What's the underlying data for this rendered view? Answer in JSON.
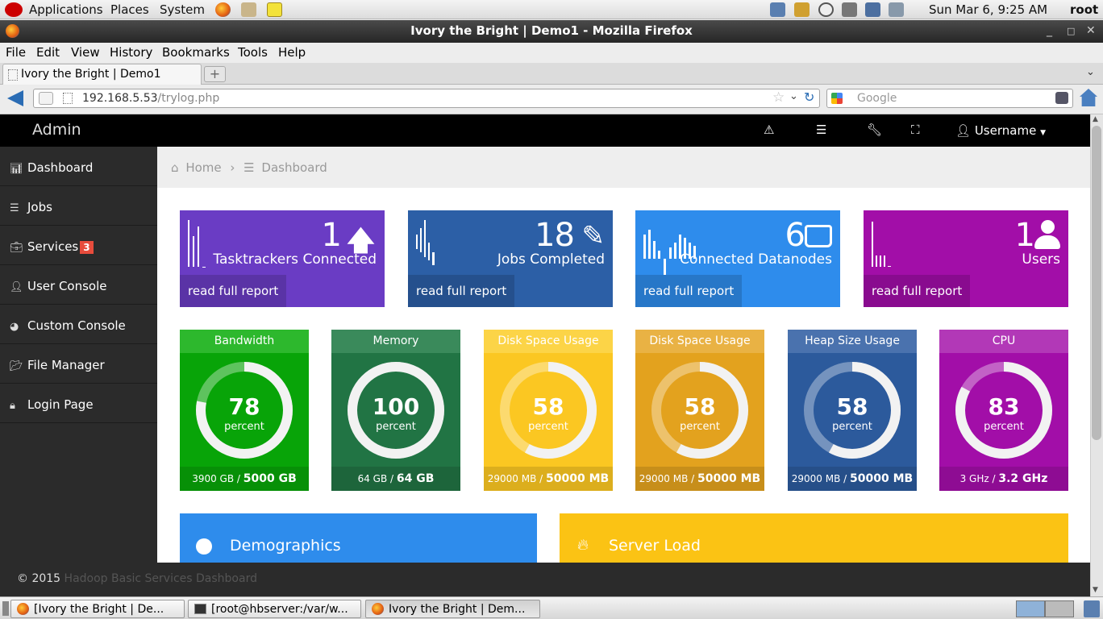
{
  "panel": {
    "menus": [
      "Applications",
      "Places",
      "System"
    ],
    "clock": "Sun Mar  6,  9:25 AM",
    "user": "root"
  },
  "window": {
    "title": "Ivory the Bright | Demo1 - Mozilla Firefox"
  },
  "menubar": [
    "File",
    "Edit",
    "View",
    "History",
    "Bookmarks",
    "Tools",
    "Help"
  ],
  "tab": {
    "title": "Ivory the Bright | Demo1",
    "new_tab": "+"
  },
  "nav": {
    "url_host": "192.168.5.53",
    "url_path": "/trylog.php",
    "search_placeholder": "Google"
  },
  "app": {
    "brand": "Admin",
    "user": "Username"
  },
  "sidebar": [
    {
      "label": "Dashboard",
      "icon": "chart-icon"
    },
    {
      "label": "Jobs",
      "icon": "list-icon"
    },
    {
      "label": "Services",
      "icon": "briefcase-icon",
      "badge": "3"
    },
    {
      "label": "User Console",
      "icon": "user-icon"
    },
    {
      "label": "Custom Console",
      "icon": "dashboard-icon"
    },
    {
      "label": "File Manager",
      "icon": "folder-open-icon"
    },
    {
      "label": "Login Page",
      "icon": "lock-icon"
    }
  ],
  "breadcrumb": {
    "home": "Home",
    "current": "Dashboard"
  },
  "cards": [
    {
      "value": "1",
      "label": "Tasktrackers Connected",
      "link": "read full report",
      "color": "#6a3cc4",
      "icon": "arrow-up-icon"
    },
    {
      "value": "18",
      "label": "Jobs Completed",
      "link": "read full report",
      "color": "#2c5fa6",
      "icon": "pencil-icon"
    },
    {
      "value": "6",
      "label": "Connected Datanodes",
      "link": "read full report",
      "color": "#2e8cec",
      "icon": "hdd-icon"
    },
    {
      "value": "1",
      "label": "Users",
      "link": "read full report",
      "color": "#a20ea8",
      "icon": "user-icon"
    }
  ],
  "gauges": [
    {
      "title": "Bandwidth",
      "value": "78",
      "unit": "percent",
      "used": "3900 GB /",
      "total": "5000 GB",
      "percent": 78,
      "color": "#08a408",
      "head": "#2db82d"
    },
    {
      "title": "Memory",
      "value": "100",
      "unit": "percent",
      "used": "64 GB /",
      "total": "64 GB",
      "percent": 100,
      "color": "#217444",
      "head": "#3a8a5b"
    },
    {
      "title": "Disk Space Usage",
      "value": "58",
      "unit": "percent",
      "used": "29000 MB /",
      "total": "50000 MB",
      "percent": 58,
      "color": "#fbc722",
      "head": "#fcd447"
    },
    {
      "title": "Disk Space Usage",
      "value": "58",
      "unit": "percent",
      "used": "29000 MB /",
      "total": "50000 MB",
      "percent": 58,
      "color": "#e3a21e",
      "head": "#e9b244"
    },
    {
      "title": "Heap Size Usage",
      "value": "58",
      "unit": "percent",
      "used": "29000 MB /",
      "total": "50000 MB",
      "percent": 58,
      "color": "#2c5a9c",
      "head": "#4a72ae"
    },
    {
      "title": "CPU",
      "value": "83",
      "unit": "percent",
      "used": "3 GHz /",
      "total": "3.2 GHz",
      "percent": 83,
      "color": "#a20ea8",
      "head": "#b238b7"
    }
  ],
  "panels": [
    {
      "title": "Demographics",
      "icon": "globe-icon",
      "color": "#2e8cec"
    },
    {
      "title": "Server Load",
      "icon": "fire-icon",
      "color": "#fbc314"
    }
  ],
  "footer": {
    "copyright": "© 2015",
    "link": "Hadoop Basic Services Dashboard"
  },
  "taskbar": [
    "[Ivory the Bright | De...",
    "[root@hbserver:/var/w...",
    "Ivory the Bright | Dem..."
  ]
}
